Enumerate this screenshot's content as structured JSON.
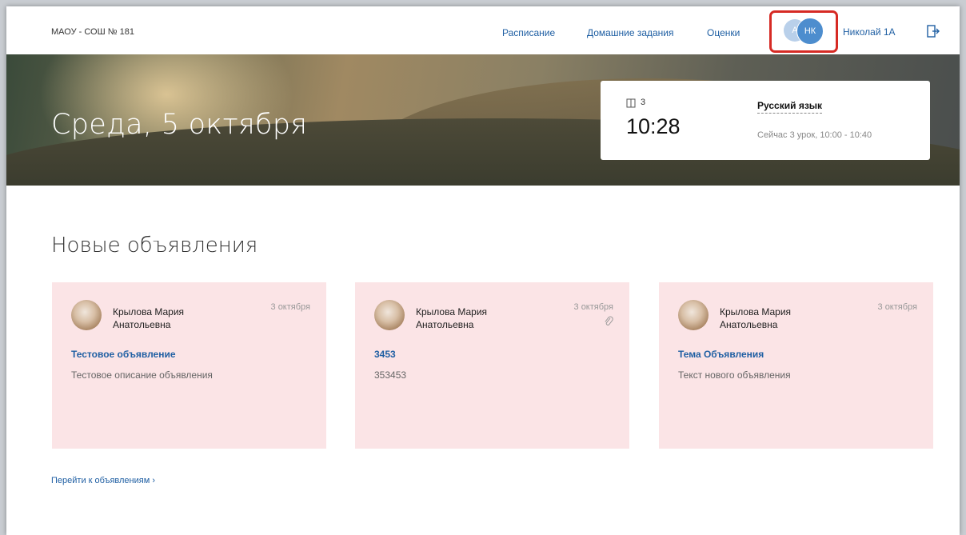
{
  "header": {
    "school": "МАОУ - СОШ № 181",
    "nav": [
      "Расписание",
      "Домашние задания",
      "Оценки"
    ],
    "avatar_secondary": "А",
    "avatar_primary": "НК",
    "user_name": "Николай 1А",
    "logout_icon": "logout-icon"
  },
  "hero": {
    "date": "Среда, 5 октября",
    "lesson": {
      "room": "3",
      "time": "10:28",
      "subject": "Русский язык",
      "status": "Сейчас 3 урок, 10:00 - 10:40"
    }
  },
  "announcements": {
    "title": "Новые объявления",
    "items": [
      {
        "author": "Крылова Мария Анатольевна",
        "date": "3 октября",
        "title": "Тестовое объявление",
        "description": "Тестовое описание объявления",
        "attachment": false
      },
      {
        "author": "Крылова Мария Анатольевна",
        "date": "3 октября",
        "title": "3453",
        "description": "353453",
        "attachment": true
      },
      {
        "author": "Крылова Мария Анатольевна",
        "date": "3 октября",
        "title": "Тема Объявления",
        "description": "Текст нового объявления",
        "attachment": false
      }
    ],
    "more_link": "Перейти к объявлениям ›"
  },
  "colors": {
    "link": "#1f5fa3",
    "card_bg": "#fbe4e6",
    "highlight": "#d62a24",
    "avatar_primary": "#4d8dce"
  }
}
